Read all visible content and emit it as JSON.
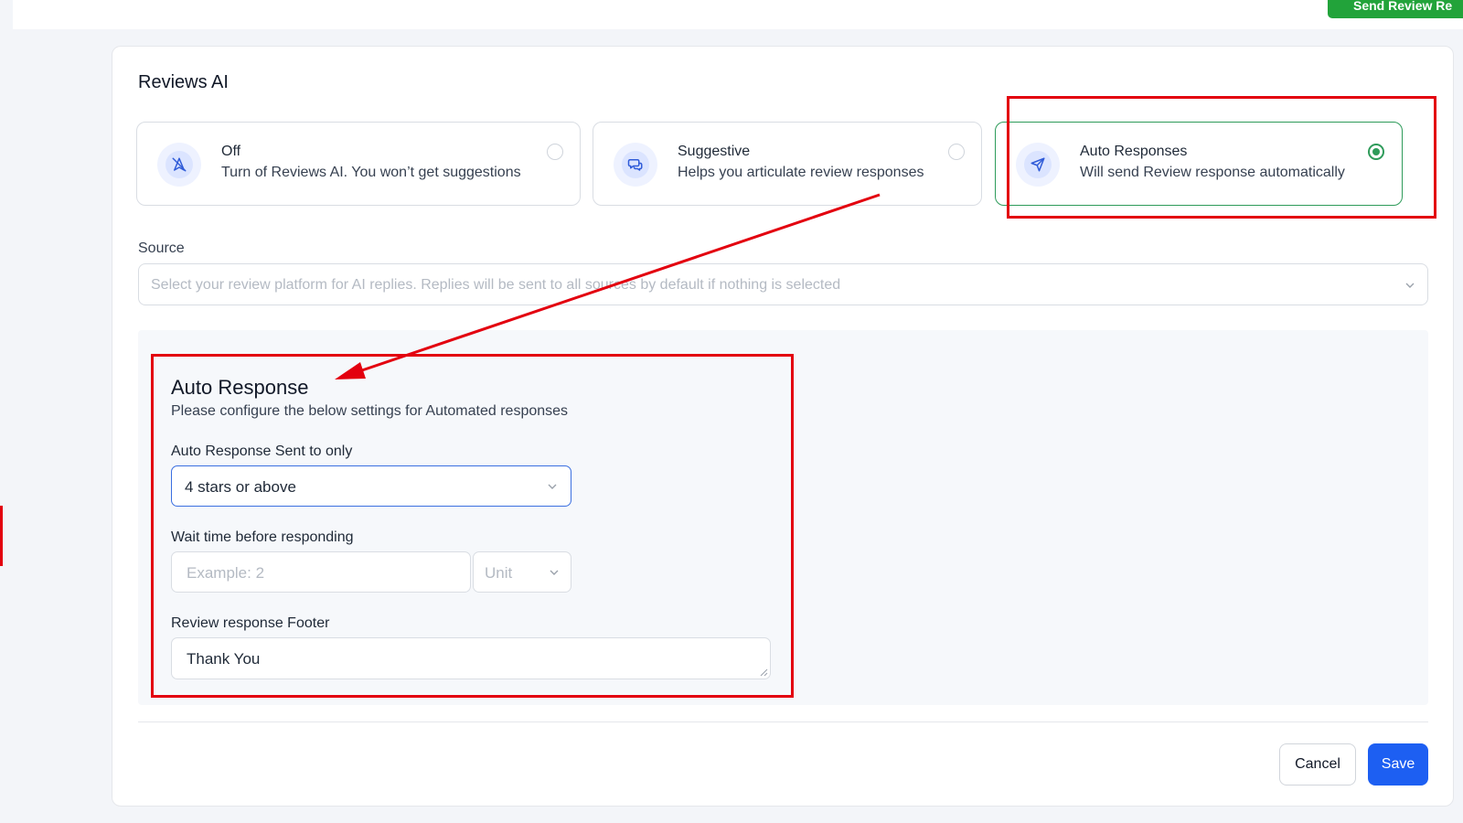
{
  "header": {
    "send_button_label": "Send Review Re"
  },
  "reviews_ai": {
    "title": "Reviews AI",
    "modes": [
      {
        "name": "Off",
        "description": "Turn of Reviews AI. You won’t get suggestions",
        "icon": "no-navigation-icon",
        "selected": false
      },
      {
        "name": "Suggestive",
        "description": "Helps you articulate review responses",
        "icon": "chat-bubbles-icon",
        "selected": false
      },
      {
        "name": "Auto Responses",
        "description": "Will send Review response automatically",
        "icon": "send-icon",
        "selected": true
      }
    ],
    "source": {
      "label": "Source",
      "placeholder": "Select your review platform for AI replies. Replies will be sent to all sources by default if nothing is selected"
    },
    "auto_response": {
      "title": "Auto Response",
      "subtitle": "Please configure the below settings for Automated responses",
      "sent_to_label": "Auto Response Sent to only",
      "sent_to_value": "4 stars or above",
      "wait_time_label": "Wait time before responding",
      "wait_time_placeholder": "Example: 2",
      "unit_placeholder": "Unit",
      "footer_label": "Review response Footer",
      "footer_value": "Thank You"
    },
    "actions": {
      "cancel_label": "Cancel",
      "save_label": "Save"
    }
  },
  "colors": {
    "accent_green": "#2e9b5a",
    "primary_blue": "#1d5ff2",
    "annotation_red": "#e3000f",
    "send_button_green": "#22a33a"
  }
}
